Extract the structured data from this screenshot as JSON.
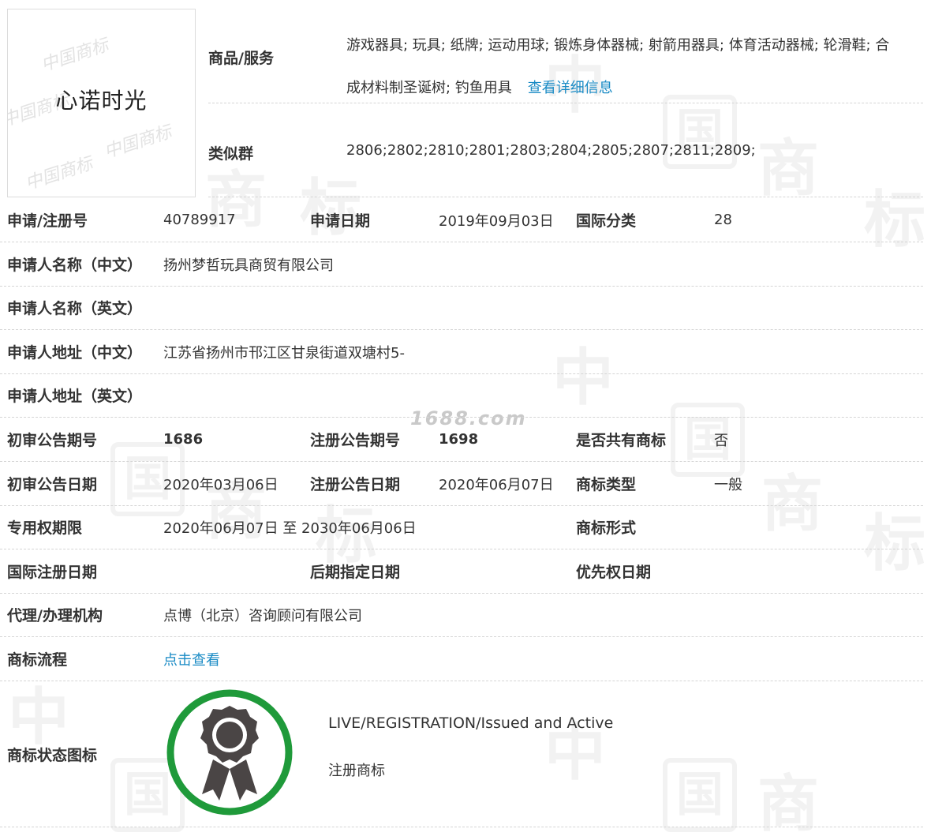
{
  "watermark": {
    "char_zhong": "中",
    "char_guo": "国",
    "char_shang": "商",
    "char_biao": "标",
    "site": "1688.com"
  },
  "logo": {
    "text": "心诺时光",
    "watermark_text": "中国商标"
  },
  "goods": {
    "label": "商品/服务",
    "value_line1": "游戏器具; 玩具; 纸牌; 运动用球; 锻炼身体器械; 射箭用器具; 体育活动器械; 轮滑鞋; 合",
    "value_line2": "成材料制圣诞树; 钓鱼用具",
    "detail_link": "查看详细信息"
  },
  "similar_group": {
    "label": "类似群",
    "value": "2806;2802;2810;2801;2803;2804;2805;2807;2811;2809;"
  },
  "rows": {
    "reg": {
      "label": "申请/注册号",
      "value": "40789917",
      "label2": "申请日期",
      "value2": "2019年09月03日",
      "label3": "国际分类",
      "value3": "28"
    },
    "applicant_cn": {
      "label": "申请人名称（中文）",
      "value": "扬州梦哲玩具商贸有限公司"
    },
    "applicant_en": {
      "label": "申请人名称（英文）",
      "value": ""
    },
    "address_cn": {
      "label": "申请人地址（中文）",
      "value": "江苏省扬州市邗江区甘泉街道双塘村5-"
    },
    "address_en": {
      "label": "申请人地址（英文）",
      "value": ""
    },
    "pub_no": {
      "label": "初审公告期号",
      "value": "1686",
      "label2": "注册公告期号",
      "value2": "1698",
      "label3": "是否共有商标",
      "value3": "否"
    },
    "pub_date": {
      "label": "初审公告日期",
      "value": "2020年03月06日",
      "label2": "注册公告日期",
      "value2": "2020年06月07日",
      "label3": "商标类型",
      "value3": "一般"
    },
    "term": {
      "label": "专用权期限",
      "value": "2020年06月07日 至 2030年06月06日",
      "label3": "商标形式",
      "value3": ""
    },
    "intl": {
      "label": "国际注册日期",
      "value": "",
      "label2": "后期指定日期",
      "value2": "",
      "label3": "优先权日期",
      "value3": ""
    },
    "agent": {
      "label": "代理/办理机构",
      "value": "点博（北京）咨询顾问有限公司"
    },
    "flow": {
      "label": "商标流程",
      "link": "点击查看"
    }
  },
  "status": {
    "label": "商标状态图标",
    "status_en": "LIVE/REGISTRATION/Issued and Active",
    "status_cn": "注册商标"
  },
  "colors": {
    "link": "#1a8bc5",
    "badge_ring": "#1f9a3a",
    "badge_medal": "#4a4545"
  }
}
